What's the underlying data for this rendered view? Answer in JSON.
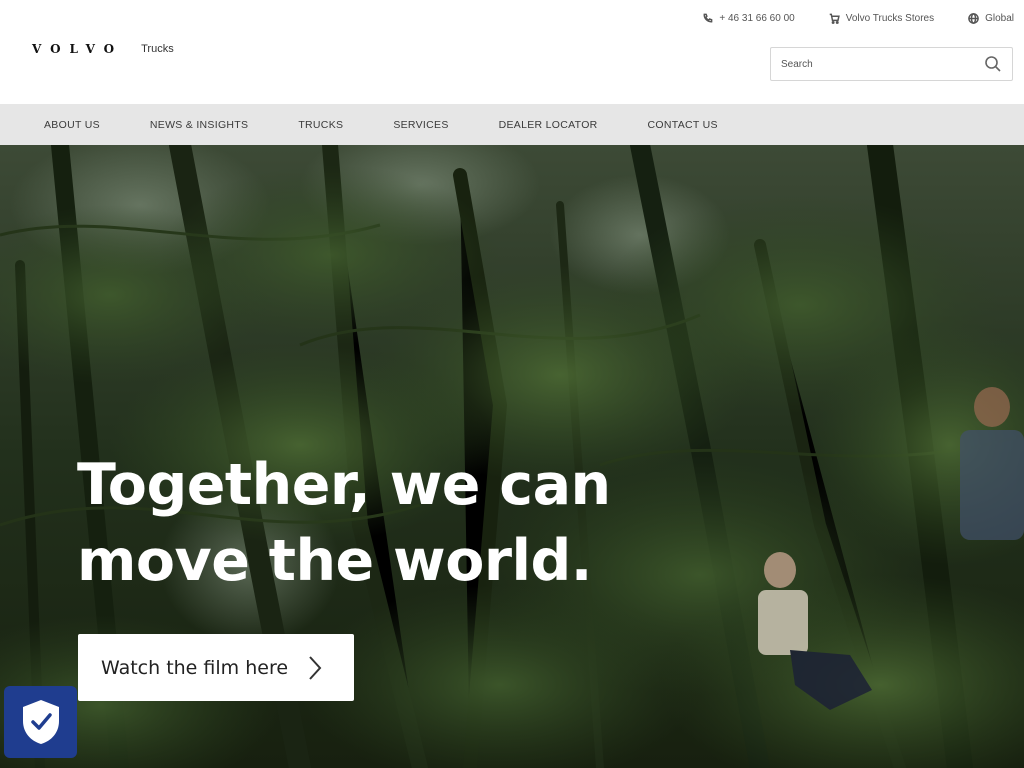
{
  "brand": {
    "wordmark": "VOLVO",
    "sub": "Trucks"
  },
  "utility": {
    "phone": "+ 46 31 66 60 00",
    "stores": "Volvo Trucks Stores",
    "global": "Global"
  },
  "search": {
    "placeholder": "Search"
  },
  "nav": {
    "items": [
      {
        "label": "ABOUT US"
      },
      {
        "label": "NEWS & INSIGHTS"
      },
      {
        "label": "TRUCKS"
      },
      {
        "label": "SERVICES"
      },
      {
        "label": "DEALER LOCATOR"
      },
      {
        "label": "CONTACT US"
      }
    ]
  },
  "hero": {
    "title": "Together, we can move the world.",
    "cta_label": "Watch the film here"
  },
  "icons": {
    "phone": "phone-icon",
    "cart": "cart-icon",
    "globe": "globe-icon",
    "search": "search-icon",
    "chevron": "chevron-right-icon",
    "shield": "shield-check-icon"
  },
  "colors": {
    "nav_background": "#e6e6e6",
    "badge_background": "#1f3d8f",
    "hero_text": "#ffffff"
  }
}
